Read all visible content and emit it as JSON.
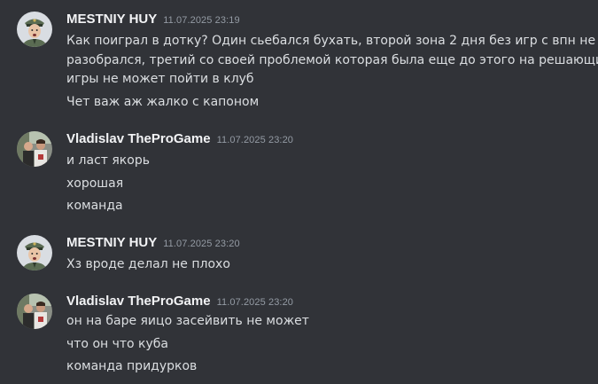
{
  "messages": [
    {
      "author": "MESTNIY HUY",
      "timestamp": "11.07.2025 23:19",
      "avatar": "policeman-avatar",
      "lines": [
        "Как поиграл в дотку? Один сьебался бухать, второй зона 2 дня без игр с впн не",
        "разобрался, третий со своей проблемой которая была еще до этого на решающие",
        "игры не может пойти в клуб",
        "Чет важ аж жалко с капоном"
      ]
    },
    {
      "author": "Vladislav TheProGame",
      "timestamp": "11.07.2025 23:20",
      "avatar": "group-photo-avatar",
      "lines": [
        "и ласт якорь",
        "хорошая",
        "команда"
      ]
    },
    {
      "author": "MESTNIY HUY",
      "timestamp": "11.07.2025 23:20",
      "avatar": "policeman-avatar",
      "lines": [
        "Хз вроде делал не плохо"
      ]
    },
    {
      "author": "Vladislav TheProGame",
      "timestamp": "11.07.2025 23:20",
      "avatar": "group-photo-avatar",
      "lines": [
        "он на баре яицо засейвить не может",
        "что он что куба",
        "команда придурков"
      ]
    }
  ],
  "colors": {
    "background": "#313338",
    "author": "#f2f3f5",
    "timestamp": "#949ba4",
    "text": "#dbdee1"
  }
}
